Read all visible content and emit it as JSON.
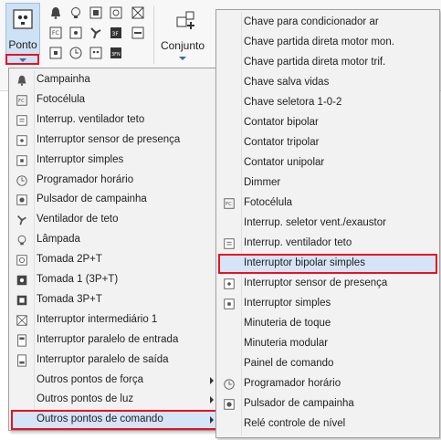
{
  "ribbon": {
    "ponto_label": "Ponto",
    "conjunto_label": "Conjunto"
  },
  "menu_pontos": [
    {
      "label": "Campainha",
      "icon": "bell-icon"
    },
    {
      "label": "Fotocélula",
      "icon": "photocell-icon"
    },
    {
      "label": "Interrup. ventilador teto",
      "icon": "fan-switch-icon"
    },
    {
      "label": "Interruptor sensor de presença",
      "icon": "presence-sensor-icon"
    },
    {
      "label": "Interruptor simples",
      "icon": "switch-icon"
    },
    {
      "label": "Programador horário",
      "icon": "timer-icon"
    },
    {
      "label": "Pulsador de campainha",
      "icon": "push-button-icon"
    },
    {
      "label": "Ventilador de teto",
      "icon": "ceiling-fan-icon"
    },
    {
      "label": "Lâmpada",
      "icon": "lamp-icon"
    },
    {
      "label": "Tomada 2P+T",
      "icon": "outlet-icon"
    },
    {
      "label": "Tomada 1 (3P+T)",
      "icon": "outlet-3p-icon"
    },
    {
      "label": "Tomada 3P+T",
      "icon": "outlet-3pt-icon"
    },
    {
      "label": "Interruptor intermediário 1",
      "icon": "intermediate-switch-icon"
    },
    {
      "label": "Interruptor paralelo de entrada",
      "icon": "parallel-switch-in-icon"
    },
    {
      "label": "Interruptor paralelo de saída",
      "icon": "parallel-switch-out-icon"
    },
    {
      "label": "Outros pontos de força",
      "icon": "",
      "submenu": true
    },
    {
      "label": "Outros pontos de luz",
      "icon": "",
      "submenu": true
    },
    {
      "label": "Outros pontos de comando",
      "icon": "",
      "submenu": true
    }
  ],
  "menu_comando": [
    {
      "label": "Chave para condicionador ar",
      "icon": ""
    },
    {
      "label": "Chave partida direta motor mon.",
      "icon": ""
    },
    {
      "label": "Chave partida direta motor trif.",
      "icon": ""
    },
    {
      "label": "Chave salva vidas",
      "icon": ""
    },
    {
      "label": "Chave seletora 1-0-2",
      "icon": ""
    },
    {
      "label": "Contator bipolar",
      "icon": ""
    },
    {
      "label": "Contator tripolar",
      "icon": ""
    },
    {
      "label": "Contator unipolar",
      "icon": ""
    },
    {
      "label": "Dimmer",
      "icon": ""
    },
    {
      "label": "Fotocélula",
      "icon": "photocell-icon"
    },
    {
      "label": "Interrup. seletor vent./exaustor",
      "icon": ""
    },
    {
      "label": "Interrup. ventilador teto",
      "icon": "fan-switch-icon"
    },
    {
      "label": "Interruptor bipolar simples",
      "icon": ""
    },
    {
      "label": "Interruptor sensor de presença",
      "icon": "presence-sensor-icon"
    },
    {
      "label": "Interruptor simples",
      "icon": "switch-icon"
    },
    {
      "label": "Minuteria de toque",
      "icon": ""
    },
    {
      "label": "Minuteria modular",
      "icon": ""
    },
    {
      "label": "Painel de comando",
      "icon": ""
    },
    {
      "label": "Programador horário",
      "icon": "timer-icon"
    },
    {
      "label": "Pulsador de campainha",
      "icon": "push-button-icon"
    },
    {
      "label": "Relé controle de nível",
      "icon": ""
    }
  ],
  "state": {
    "highlighted_pontos_item": "Outros pontos de comando",
    "highlighted_comando_item": "Interruptor bipolar simples"
  },
  "colors": {
    "highlight": "#d5e4f6",
    "annotation_box": "#e81123",
    "menu_bg": "#f2f2f2"
  }
}
